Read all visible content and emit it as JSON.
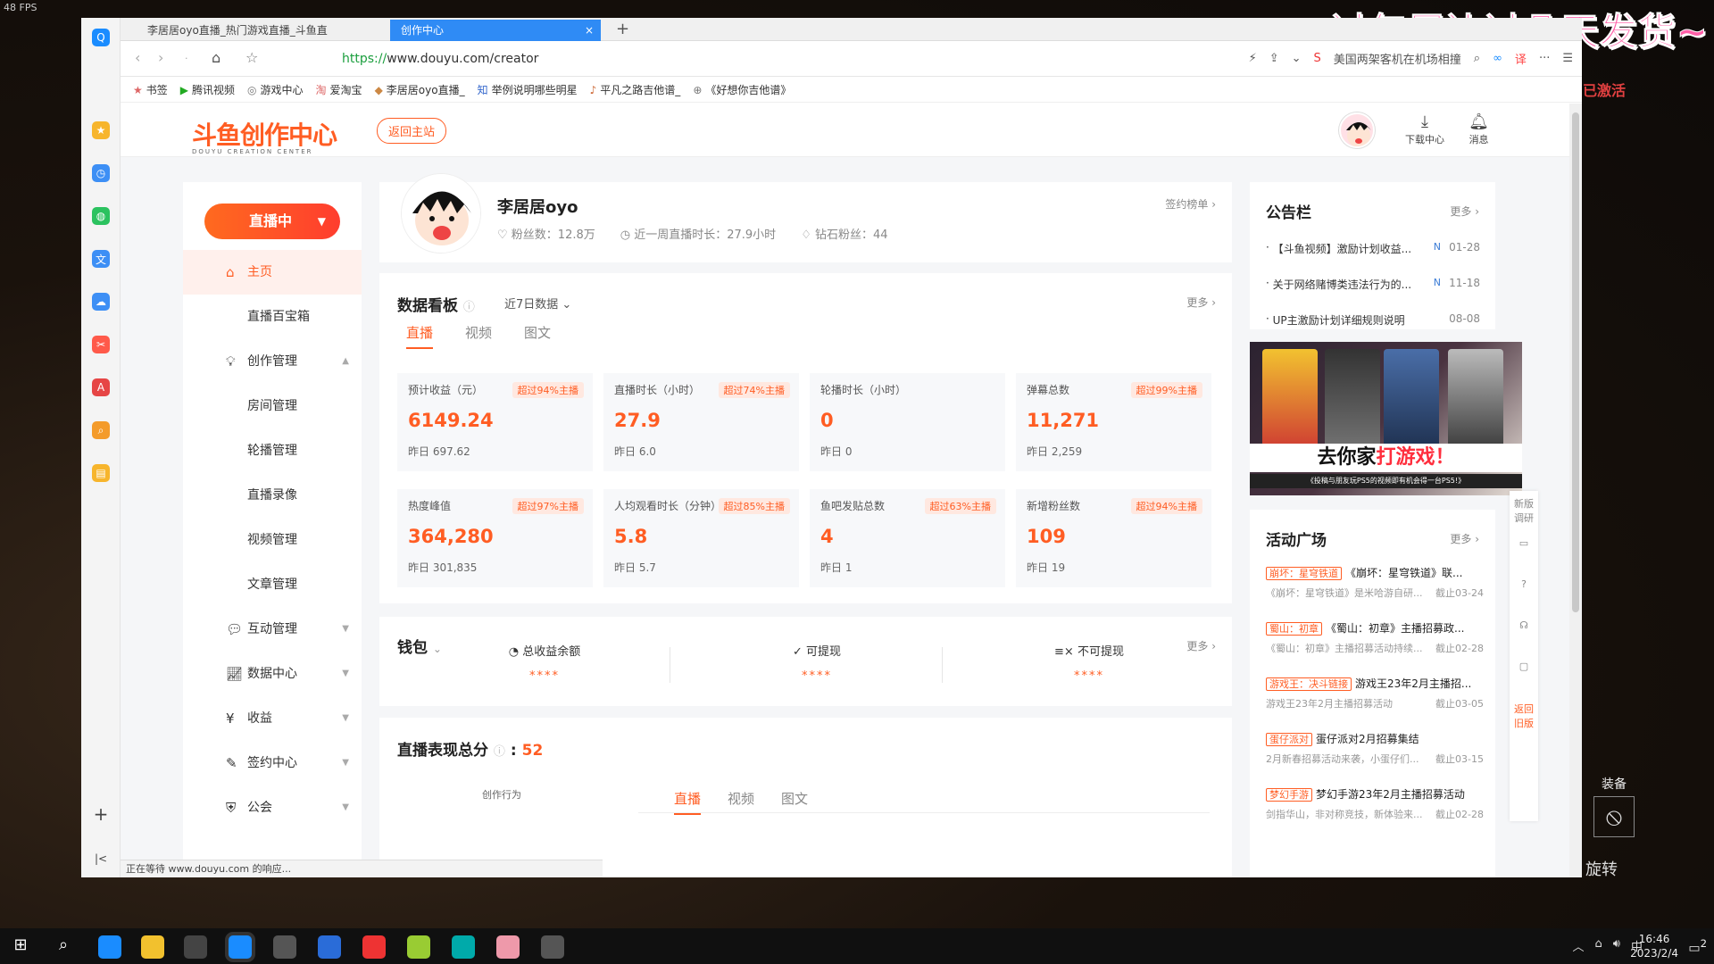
{
  "overlay": {
    "fps": "48 FPS",
    "banner_text": "过年周边过几天发货~",
    "activated": "已激活",
    "equip": "装备",
    "spin": "旋转"
  },
  "browser": {
    "tabs": [
      {
        "title": "李居居oyo直播_热门游戏直播_斗鱼直"
      },
      {
        "title": "创作中心"
      }
    ],
    "url_scheme": "https://",
    "url_rest": "www.douyu.com/creator",
    "search_hint": "美国两架客机在机场相撞",
    "bookmarks": [
      "书签",
      "腾讯视频",
      "游戏中心",
      "爱淘宝",
      "李居居oyo直播_",
      "举例说明哪些明星",
      "平凡之路吉他谱_",
      "《好想你吉他谱》"
    ],
    "status": "正在等待 www.douyu.com 的响应..."
  },
  "header": {
    "logo": "斗鱼创作中心",
    "logo_sub": "DOUYU CREATION CENTER",
    "back_home": "返回主站",
    "download": "下载中心",
    "messages": "消息"
  },
  "menu": {
    "live_button": "直播中",
    "items": [
      {
        "label": "主页",
        "icon": "home-icon"
      },
      {
        "label": "直播百宝箱"
      },
      {
        "label": "创作管理",
        "icon": "bulb-icon"
      },
      {
        "label": "房间管理"
      },
      {
        "label": "轮播管理"
      },
      {
        "label": "直播录像"
      },
      {
        "label": "视频管理"
      },
      {
        "label": "文章管理"
      },
      {
        "label": "互动管理",
        "icon": "chat-icon"
      },
      {
        "label": "数据中心",
        "icon": "chart-icon"
      },
      {
        "label": "收益",
        "icon": "money-icon"
      },
      {
        "label": "签约中心",
        "icon": "pen-icon"
      },
      {
        "label": "公会",
        "icon": "guild-icon"
      }
    ]
  },
  "profile": {
    "name": "李居居oyo",
    "fans": "粉丝数：12.8万",
    "live_time": "近一周直播时长：27.9小时",
    "diamond_fans": "钻石粉丝：44",
    "sign_rank": "签约榜单"
  },
  "dashboard": {
    "title": "数据看板",
    "range": "近7日数据",
    "more": "更多",
    "tabs": [
      "直播",
      "视频",
      "图文"
    ],
    "tiles": [
      {
        "label": "预计收益（元）",
        "badge": "超过94%主播",
        "value": "6149.24",
        "prev": "昨日 697.62"
      },
      {
        "label": "直播时长（小时）",
        "badge": "超过74%主播",
        "value": "27.9",
        "prev": "昨日 6.0"
      },
      {
        "label": "轮播时长（小时）",
        "badge": "",
        "value": "0",
        "prev": "昨日 0"
      },
      {
        "label": "弹幕总数",
        "badge": "超过99%主播",
        "value": "11,271",
        "prev": "昨日 2,259"
      },
      {
        "label": "热度峰值",
        "badge": "超过97%主播",
        "value": "364,280",
        "prev": "昨日 301,835"
      },
      {
        "label": "人均观看时长（分钟）",
        "badge": "超过85%主播",
        "value": "5.8",
        "prev": "昨日 5.7"
      },
      {
        "label": "鱼吧发贴总数",
        "badge": "超过63%主播",
        "value": "4",
        "prev": "昨日 1"
      },
      {
        "label": "新增粉丝数",
        "badge": "超过94%主播",
        "value": "109",
        "prev": "昨日 19"
      }
    ]
  },
  "wallet": {
    "title": "钱包",
    "more": "更多",
    "cols": [
      {
        "label": "总收益余额",
        "value": "****"
      },
      {
        "label": "可提现",
        "value": "****"
      },
      {
        "label": "不可提现",
        "value": "****"
      }
    ]
  },
  "perf": {
    "title": "直播表现总分",
    "score": "52",
    "radar_label": "创作行为",
    "tabs": [
      "直播",
      "视频",
      "图文"
    ]
  },
  "notice": {
    "title": "公告栏",
    "more": "更多",
    "items": [
      {
        "text": "【斗鱼视频】激励计划收益...",
        "date": "01-28",
        "new": "N"
      },
      {
        "text": "关于网络赌博类违法行为的...",
        "date": "11-18",
        "new": "N"
      },
      {
        "text": "UP主激励计划详细规则说明",
        "date": "08-08",
        "new": ""
      }
    ]
  },
  "promo": {
    "headline_a": "去你家",
    "headline_b": "打游戏！",
    "sub": "《投稿与朋友玩PS5的视频即有机会得一台PS5!》"
  },
  "activities": {
    "title": "活动广场",
    "more": "更多",
    "items": [
      {
        "tag": "崩坏：星穹铁道",
        "title": "《崩坏：星穹铁道》联...",
        "desc": "《崩坏：星穹铁道》是米哈游自研...",
        "deadline": "截止03-24"
      },
      {
        "tag": "蜀山：初章",
        "title": "《蜀山：初章》主播招募政...",
        "desc": "《蜀山：初章》主播招募活动持续...",
        "deadline": "截止02-28"
      },
      {
        "tag": "游戏王：决斗链接",
        "title": "游戏王23年2月主播招...",
        "desc": "游戏王23年2月主播招募活动",
        "deadline": "截止03-05"
      },
      {
        "tag": "蛋仔派对",
        "title": "蛋仔派对2月招募集结",
        "desc": "2月新春招募活动来袭，小蛋仔们...",
        "deadline": "截止03-15"
      },
      {
        "tag": "梦幻手游",
        "title": "梦幻手游23年2月主播招募活动",
        "desc": "剑指华山，非对称竞技，新体验来...",
        "deadline": "截止02-28"
      }
    ]
  },
  "floatbar": {
    "survey": "新版调研",
    "old": "返回旧版"
  },
  "taskbar": {
    "time": "16:46",
    "date": "2023/2/4",
    "ime": "中",
    "notif_count": "2"
  }
}
